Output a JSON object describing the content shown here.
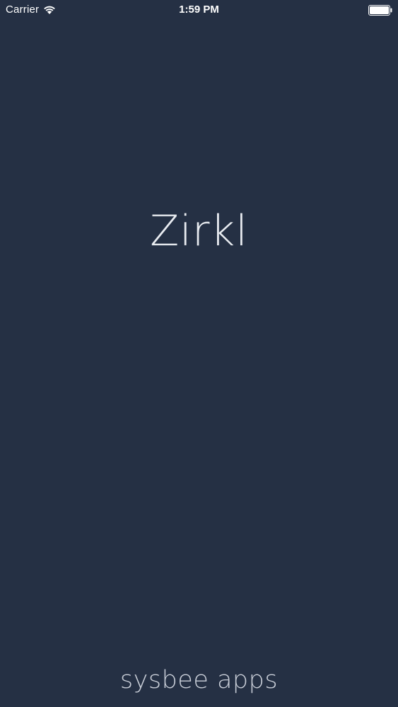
{
  "status_bar": {
    "carrier": "Carrier",
    "time": "1:59 PM",
    "icons": [
      "wifi-icon",
      "battery-icon"
    ]
  },
  "splash": {
    "title": "Zirkl",
    "footer": "sysbee apps"
  },
  "colors": {
    "background": "#253044",
    "title_text": "#e9ecf1",
    "footer_text": "#c9ced8"
  }
}
